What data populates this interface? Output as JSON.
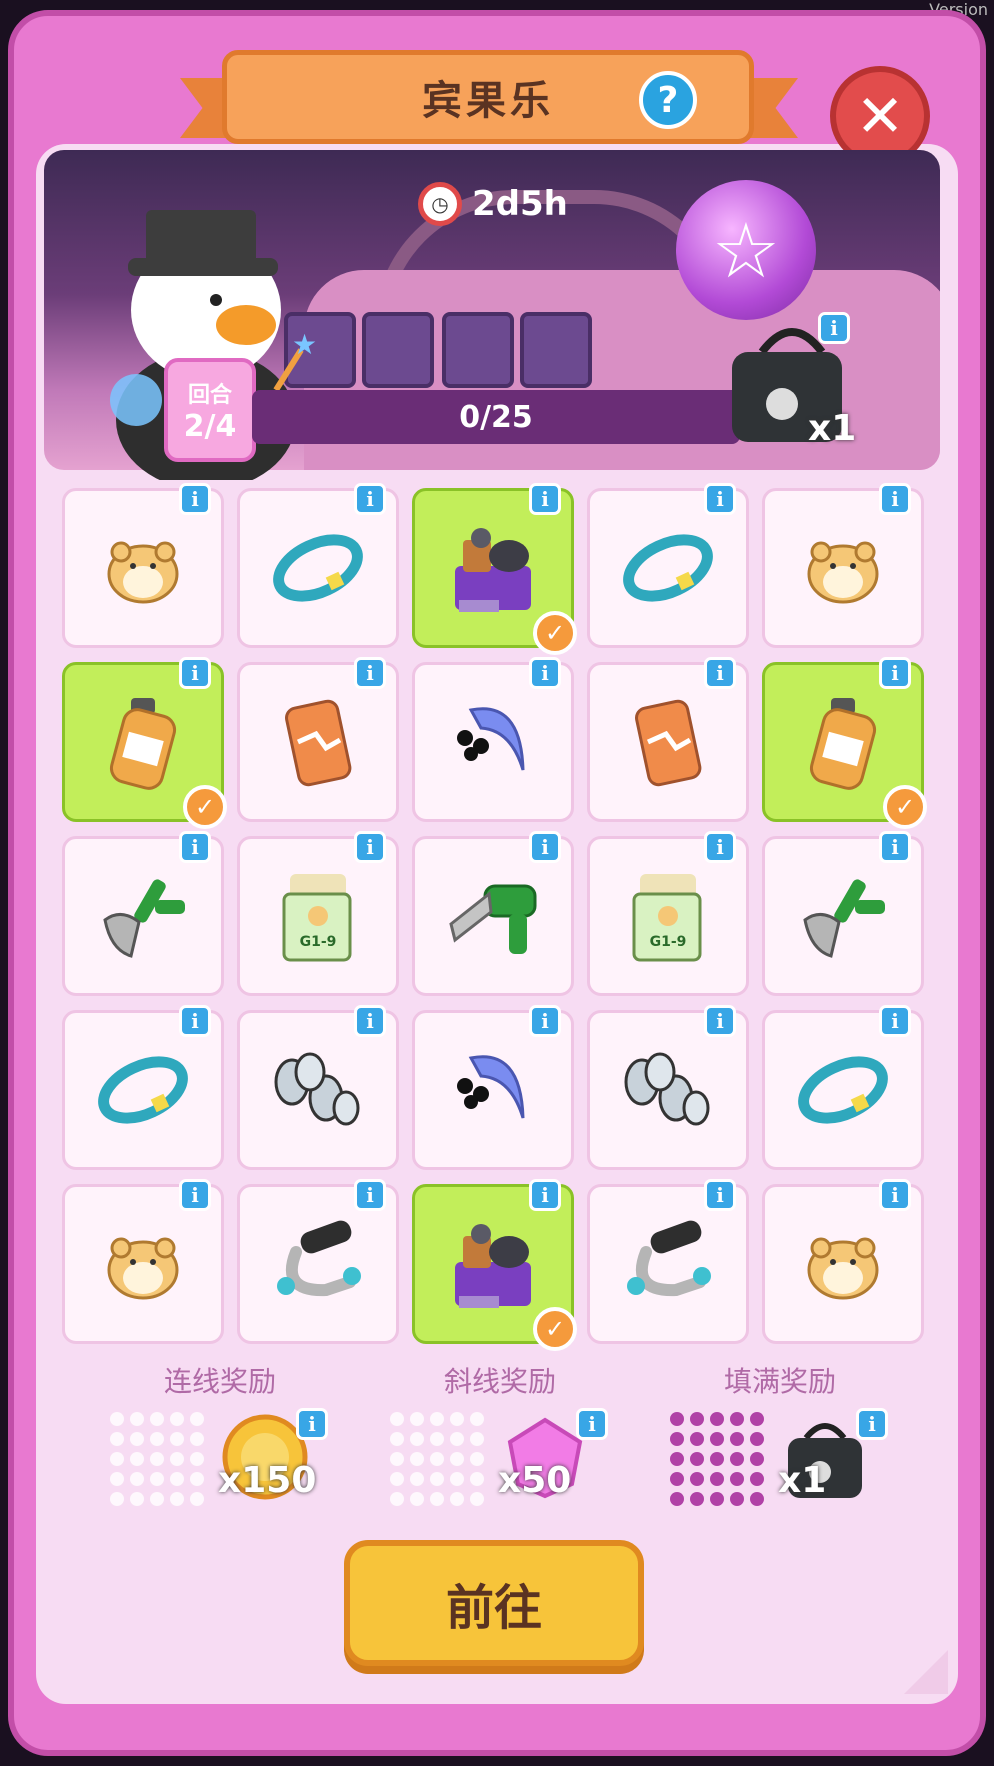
{
  "version_label": "Version",
  "header": {
    "title": "宾果乐",
    "help_label": "?",
    "close_label": "✕"
  },
  "event": {
    "timer": "2d5h",
    "round_label": "回合",
    "round_value": "2/4",
    "progress_text": "0/25",
    "bag_qty": "x1"
  },
  "grid": {
    "cells": [
      {
        "item": "hamster-icon",
        "done": false
      },
      {
        "item": "ring-icon",
        "done": false
      },
      {
        "item": "junk-pile-icon",
        "done": true
      },
      {
        "item": "ring-icon",
        "done": false
      },
      {
        "item": "hamster-icon",
        "done": false
      },
      {
        "item": "bottle-icon",
        "done": true
      },
      {
        "item": "can-icon",
        "done": false
      },
      {
        "item": "hairdryer-icon",
        "done": false
      },
      {
        "item": "can-icon",
        "done": false
      },
      {
        "item": "bottle-icon",
        "done": true
      },
      {
        "item": "pliers-icon",
        "done": false
      },
      {
        "item": "seed-packet-icon",
        "done": false
      },
      {
        "item": "drill-icon",
        "done": false
      },
      {
        "item": "seed-packet-icon",
        "done": false
      },
      {
        "item": "pliers-icon",
        "done": false
      },
      {
        "item": "ring-icon",
        "done": false
      },
      {
        "item": "dumbbell-icon",
        "done": false
      },
      {
        "item": "hairdryer-icon",
        "done": false
      },
      {
        "item": "dumbbell-icon",
        "done": false
      },
      {
        "item": "ring-icon",
        "done": false
      },
      {
        "item": "hamster-icon",
        "done": false
      },
      {
        "item": "gym-grip-icon",
        "done": false
      },
      {
        "item": "junk-pile-icon",
        "done": true
      },
      {
        "item": "gym-grip-icon",
        "done": false
      },
      {
        "item": "hamster-icon",
        "done": false
      }
    ],
    "seed_text": "G1-9"
  },
  "rewards": [
    {
      "label": "连线奖励",
      "qty": "x150",
      "icon": "coin-icon",
      "pattern": "line"
    },
    {
      "label": "斜线奖励",
      "qty": "x50",
      "icon": "gem-icon",
      "pattern": "diagonal"
    },
    {
      "label": "填满奖励",
      "qty": "x1",
      "icon": "bag-icon",
      "pattern": "full"
    }
  ],
  "go_button": "前往",
  "colors": {
    "panel": "#e879d0",
    "cell_done": "#c2ee5a",
    "accent": "#f59a3c"
  }
}
